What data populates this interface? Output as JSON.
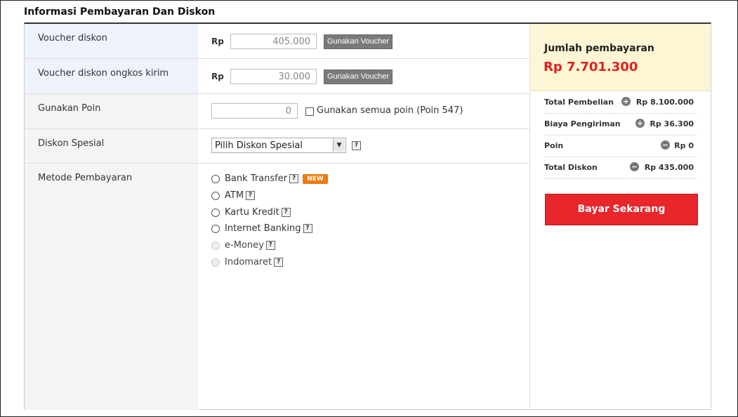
{
  "section": {
    "title": "Informasi Pembayaran Dan Diskon"
  },
  "voucher": {
    "label": "Voucher diskon",
    "currency": "Rp",
    "value": "405.000",
    "button": "Gunakan Voucher"
  },
  "shipping_voucher": {
    "label": "Voucher diskon ongkos kirim",
    "currency": "Rp",
    "value": "30.000",
    "button": "Gunakan Voucher"
  },
  "points": {
    "label": "Gunakan Poin",
    "value": "0",
    "use_all_label": "Gunakan semua poin (Poin 547)",
    "use_all_checked": false
  },
  "special_discount": {
    "label": "Diskon Spesial",
    "selected": "Pilih Diskon Spesial",
    "help": "?"
  },
  "payment_method": {
    "label": "Metode Pembayaran",
    "options": [
      {
        "label": "Bank Transfer",
        "help": "?",
        "badge": "NEW",
        "enabled": true
      },
      {
        "label": "ATM",
        "help": "?",
        "enabled": true
      },
      {
        "label": "Kartu Kredit",
        "help": "?",
        "enabled": true
      },
      {
        "label": "Internet Banking",
        "help": "?",
        "enabled": true
      },
      {
        "label": "e-Money",
        "help": "?",
        "enabled": false
      },
      {
        "label": "Indomaret",
        "help": "?",
        "enabled": false
      }
    ]
  },
  "summary": {
    "total_label": "Jumlah pembayaran",
    "total_value": "Rp 7.701.300",
    "rows": [
      {
        "label": "Total Pembelian",
        "op": "+",
        "value": "Rp 8.100.000"
      },
      {
        "label": "Biaya Pengiriman",
        "op": "+",
        "value": "Rp 36.300"
      },
      {
        "label": "Poin",
        "op": "−",
        "value": "Rp 0"
      },
      {
        "label": "Total Diskon",
        "op": "−",
        "value": "Rp 435.000"
      }
    ],
    "pay_button": "Bayar Sekarang"
  },
  "colors": {
    "accent_red": "#e8262c",
    "badge_orange": "#f07b10",
    "total_bg": "#fdf6d4"
  }
}
